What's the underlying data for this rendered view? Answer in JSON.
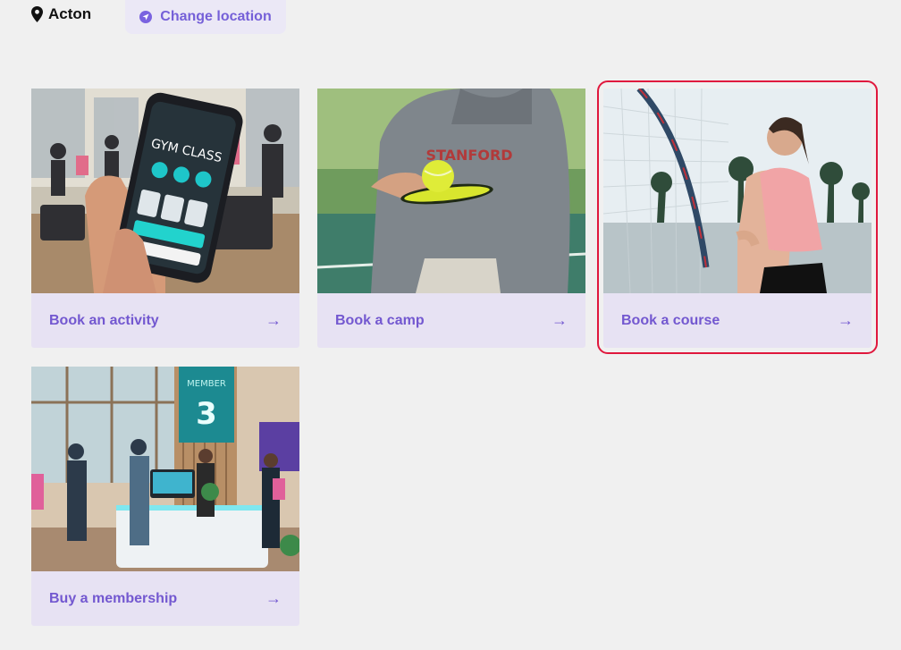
{
  "location": {
    "current": "Acton",
    "change_label": "Change location"
  },
  "cards": [
    {
      "label": "Book an activity",
      "image": "gym-class-phone-image"
    },
    {
      "label": "Book a camp",
      "image": "tennis-camp-image"
    },
    {
      "label": "Book a course",
      "image": "tennis-course-image"
    },
    {
      "label": "Buy a membership",
      "image": "gym-membership-image"
    }
  ],
  "colors": {
    "accent": "#7358d0",
    "card_bg": "#e7e2f3",
    "highlight": "#e0183d",
    "page_bg": "#f0f0f0"
  }
}
